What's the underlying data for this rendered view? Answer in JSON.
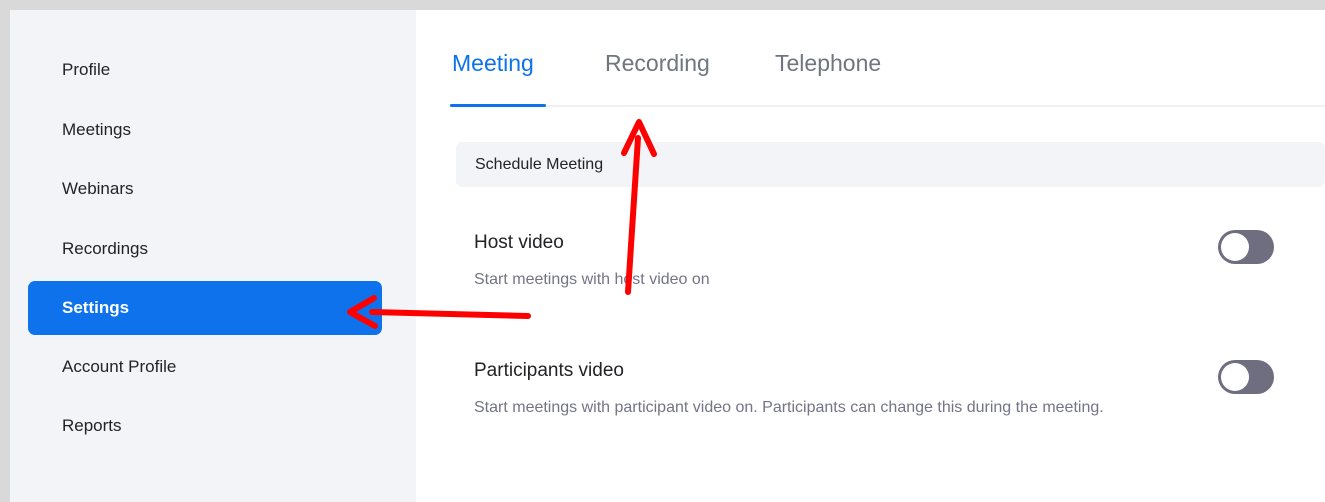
{
  "sidebar": {
    "items": [
      {
        "label": "Profile",
        "active": false
      },
      {
        "label": "Meetings",
        "active": false
      },
      {
        "label": "Webinars",
        "active": false
      },
      {
        "label": "Recordings",
        "active": false
      },
      {
        "label": "Settings",
        "active": true
      },
      {
        "label": "Account Profile",
        "active": false
      },
      {
        "label": "Reports",
        "active": false
      }
    ]
  },
  "tabs": [
    {
      "label": "Meeting",
      "active": true
    },
    {
      "label": "Recording",
      "active": false
    },
    {
      "label": "Telephone",
      "active": false
    }
  ],
  "section": {
    "title": "Schedule Meeting"
  },
  "settings": [
    {
      "title": "Host video",
      "description": "Start meetings with host video on",
      "enabled": false
    },
    {
      "title": "Participants video",
      "description": "Start meetings with participant video on. Participants can change this during the meeting.",
      "enabled": false
    }
  ],
  "annotations": {
    "arrow_color": "#ff0000"
  },
  "colors": {
    "accent": "#0e72ed",
    "toggle_off": "#6e6e80"
  }
}
